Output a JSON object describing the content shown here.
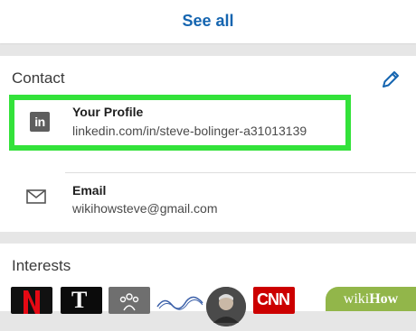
{
  "see_all": {
    "label": "See all"
  },
  "contact": {
    "title": "Contact",
    "edit_icon": "pencil-icon",
    "profile": {
      "icon": "linkedin-icon",
      "icon_text": "in",
      "title": "Your Profile",
      "url": "linkedin.com/in/steve-bolinger-a31013139"
    },
    "email": {
      "icon": "mail-icon",
      "title": "Email",
      "value": "wikihowsteve@gmail.com"
    }
  },
  "interests": {
    "title": "Interests",
    "items": [
      {
        "name": "netflix-logo"
      },
      {
        "name": "nyt-logo",
        "text": "T"
      },
      {
        "name": "group-logo"
      },
      {
        "name": "cma-logo"
      },
      {
        "name": "person-photo"
      },
      {
        "name": "cnn-logo",
        "text": "CNN"
      }
    ]
  },
  "watermark": {
    "wiki": "wiki",
    "how": "How"
  },
  "colors": {
    "link": "#1565b0",
    "highlight": "#33e23a",
    "watermark": "#92b64a"
  }
}
